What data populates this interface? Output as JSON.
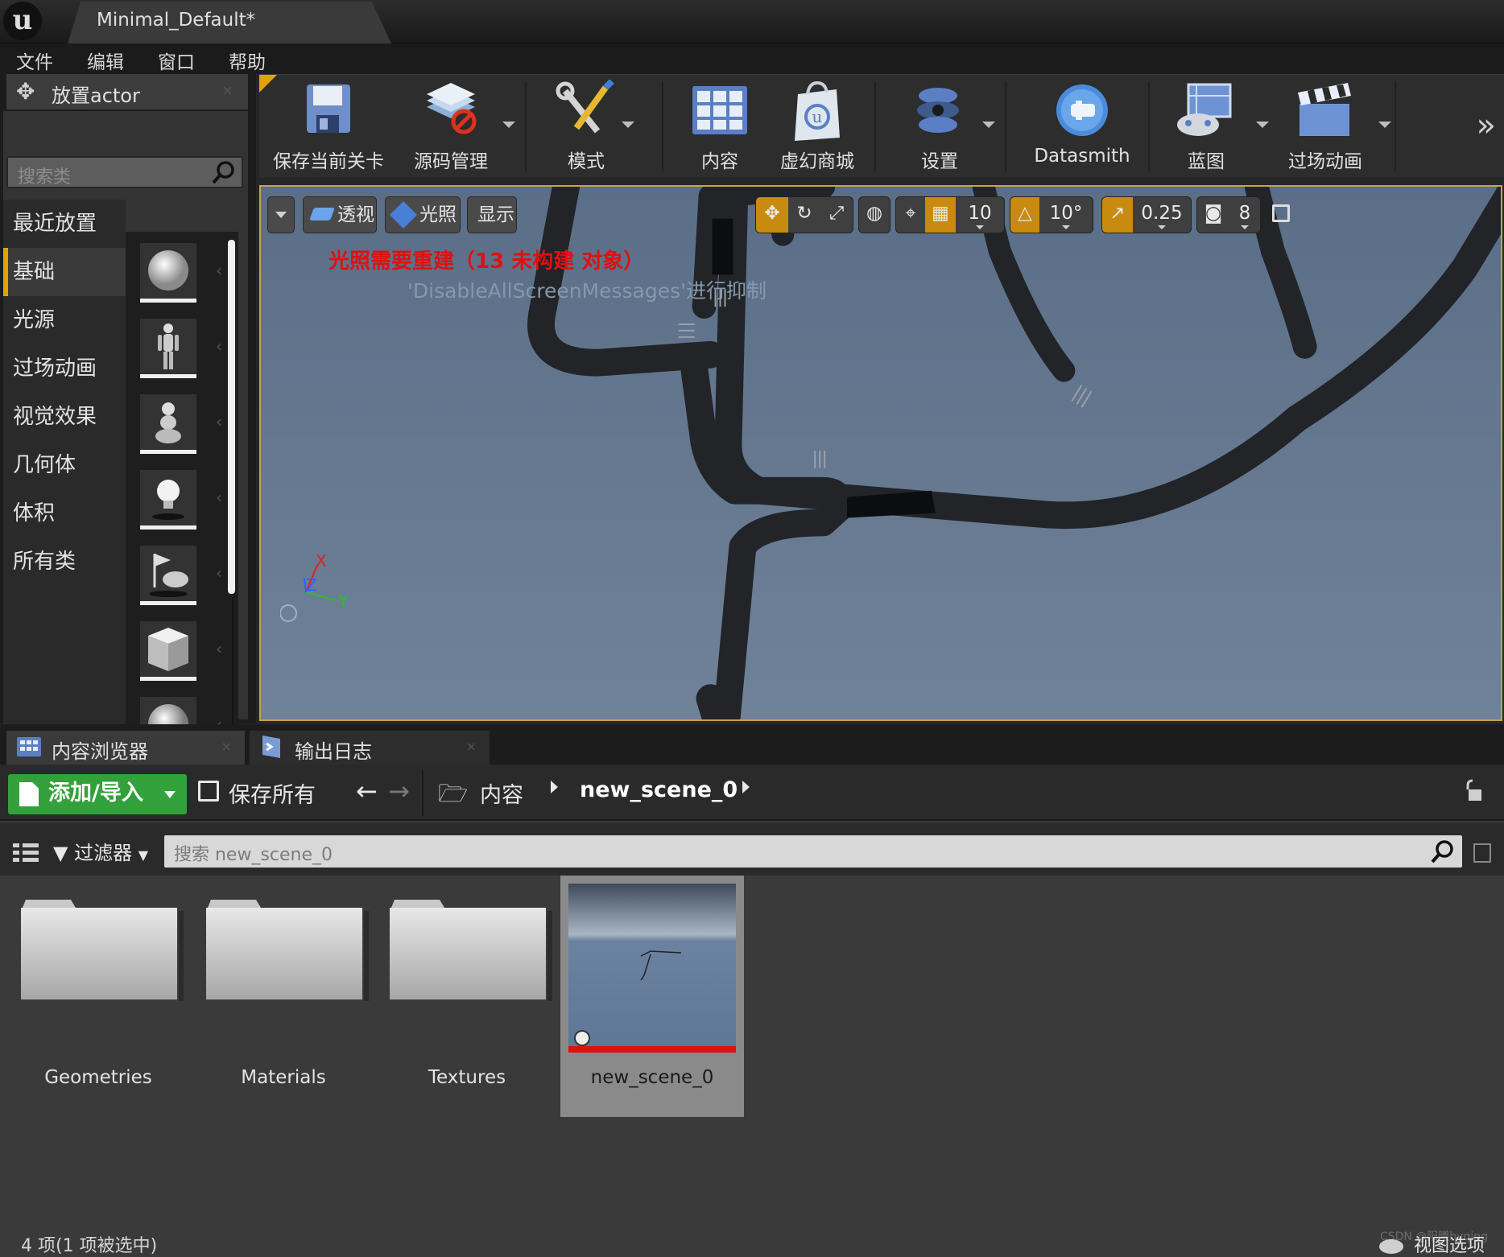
{
  "window": {
    "title": "Minimal_Default*",
    "logo": "ue-logo"
  },
  "menu": [
    "文件",
    "编辑",
    "窗口",
    "帮助"
  ],
  "place_panel": {
    "tab_label": "放置actor",
    "search_placeholder": "搜索类",
    "categories": [
      "最近放置",
      "基础",
      "光源",
      "过场动画",
      "视觉效果",
      "几何体",
      "体积",
      "所有类"
    ],
    "active_category": "基础",
    "tiles": [
      "sphere-icon",
      "mannequin-icon",
      "pawn-icon",
      "light-bulb-icon",
      "player-start-icon",
      "cube-icon",
      "sphere-icon",
      "cylinder-icon"
    ]
  },
  "toolbar": {
    "buttons": [
      {
        "label": "保存当前关卡",
        "icon": "floppy-save-icon"
      },
      {
        "label": "源码管理",
        "icon": "source-control-icon"
      },
      {
        "label": "模式",
        "icon": "modes-tools-icon"
      },
      {
        "label": "内容",
        "icon": "content-grid-icon"
      },
      {
        "label": "虚幻商城",
        "icon": "marketplace-bag-icon"
      },
      {
        "label": "设置",
        "icon": "settings-gear-icon"
      },
      {
        "label": "Datasmith",
        "icon": "datasmith-icon"
      },
      {
        "label": "蓝图",
        "icon": "blueprint-icon"
      },
      {
        "label": "过场动画",
        "icon": "clapperboard-icon"
      }
    ]
  },
  "viewport": {
    "view_mode": "透视",
    "lighting": "光照",
    "show": "显示",
    "grid_snap": "10",
    "rotation_snap": "10°",
    "scale_snap": "0.25",
    "camera_speed": "8",
    "warning": "光照需要重建（13 未构建 对象）",
    "suppress_msg": "'DisableAllScreenMessages'进行抑制",
    "axes": {
      "x": "X",
      "y": "Y",
      "z": "Z"
    },
    "colors": {
      "warning": "#e01010",
      "accent": "#c9a347"
    }
  },
  "bottom_tabs": [
    {
      "label": "内容浏览器",
      "icon": "content-browser-icon"
    },
    {
      "label": "输出日志",
      "icon": "output-log-icon"
    }
  ],
  "content_browser": {
    "add_import": "添加/导入",
    "save_all": "保存所有",
    "breadcrumb": [
      "内容",
      "new_scene_0"
    ],
    "filters": "过滤器",
    "search_placeholder": "搜索 new_scene_0",
    "assets": [
      {
        "name": "Geometries",
        "type": "folder"
      },
      {
        "name": "Materials",
        "type": "folder"
      },
      {
        "name": "Textures",
        "type": "folder"
      },
      {
        "name": "new_scene_0",
        "type": "level",
        "selected": true
      }
    ],
    "status": "4 项(1 项被选中)",
    "view_options": "视图选项",
    "watermark": "CSDN @阳曦hyqing"
  }
}
